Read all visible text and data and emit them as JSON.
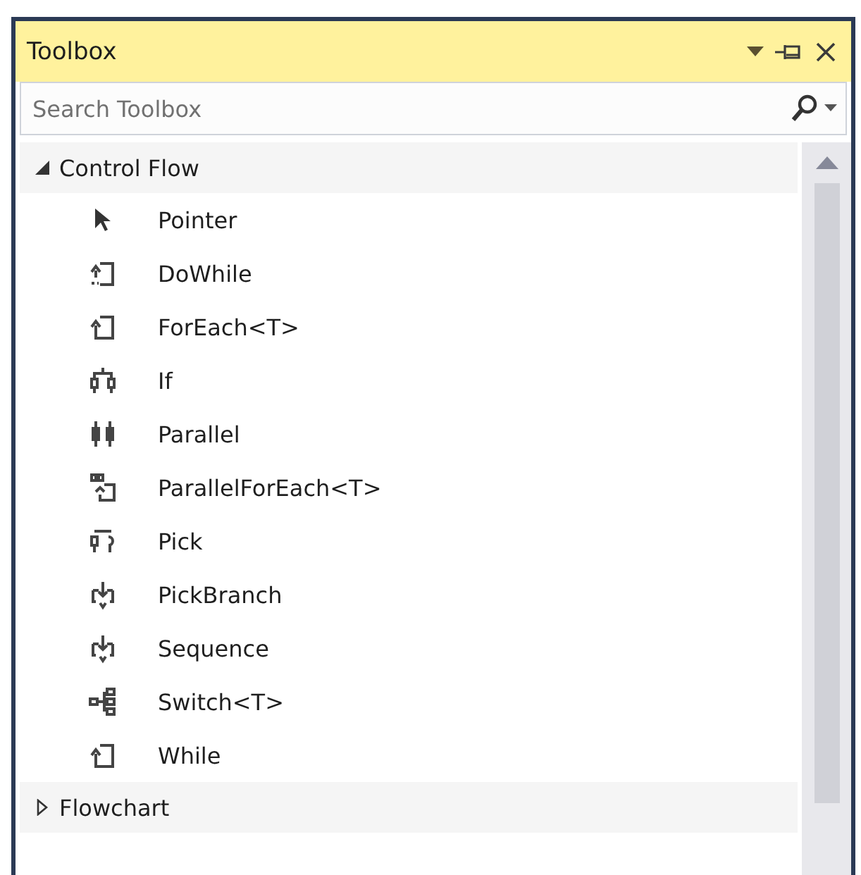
{
  "window": {
    "title": "Toolbox"
  },
  "search": {
    "placeholder": "Search Toolbox"
  },
  "groups": [
    {
      "name": "Control Flow",
      "expanded": true,
      "items": [
        {
          "label": "Pointer",
          "kind": "pointer"
        },
        {
          "label": "DoWhile",
          "kind": "dowhile"
        },
        {
          "label": "ForEach<T>",
          "kind": "foreach"
        },
        {
          "label": "If",
          "kind": "if"
        },
        {
          "label": "Parallel",
          "kind": "parallel"
        },
        {
          "label": "ParallelForEach<T>",
          "kind": "parallelforeach"
        },
        {
          "label": "Pick",
          "kind": "pick"
        },
        {
          "label": "PickBranch",
          "kind": "pickbranch"
        },
        {
          "label": "Sequence",
          "kind": "sequence"
        },
        {
          "label": "Switch<T>",
          "kind": "switch"
        },
        {
          "label": "While",
          "kind": "while"
        }
      ]
    },
    {
      "name": "Flowchart",
      "expanded": false
    }
  ]
}
